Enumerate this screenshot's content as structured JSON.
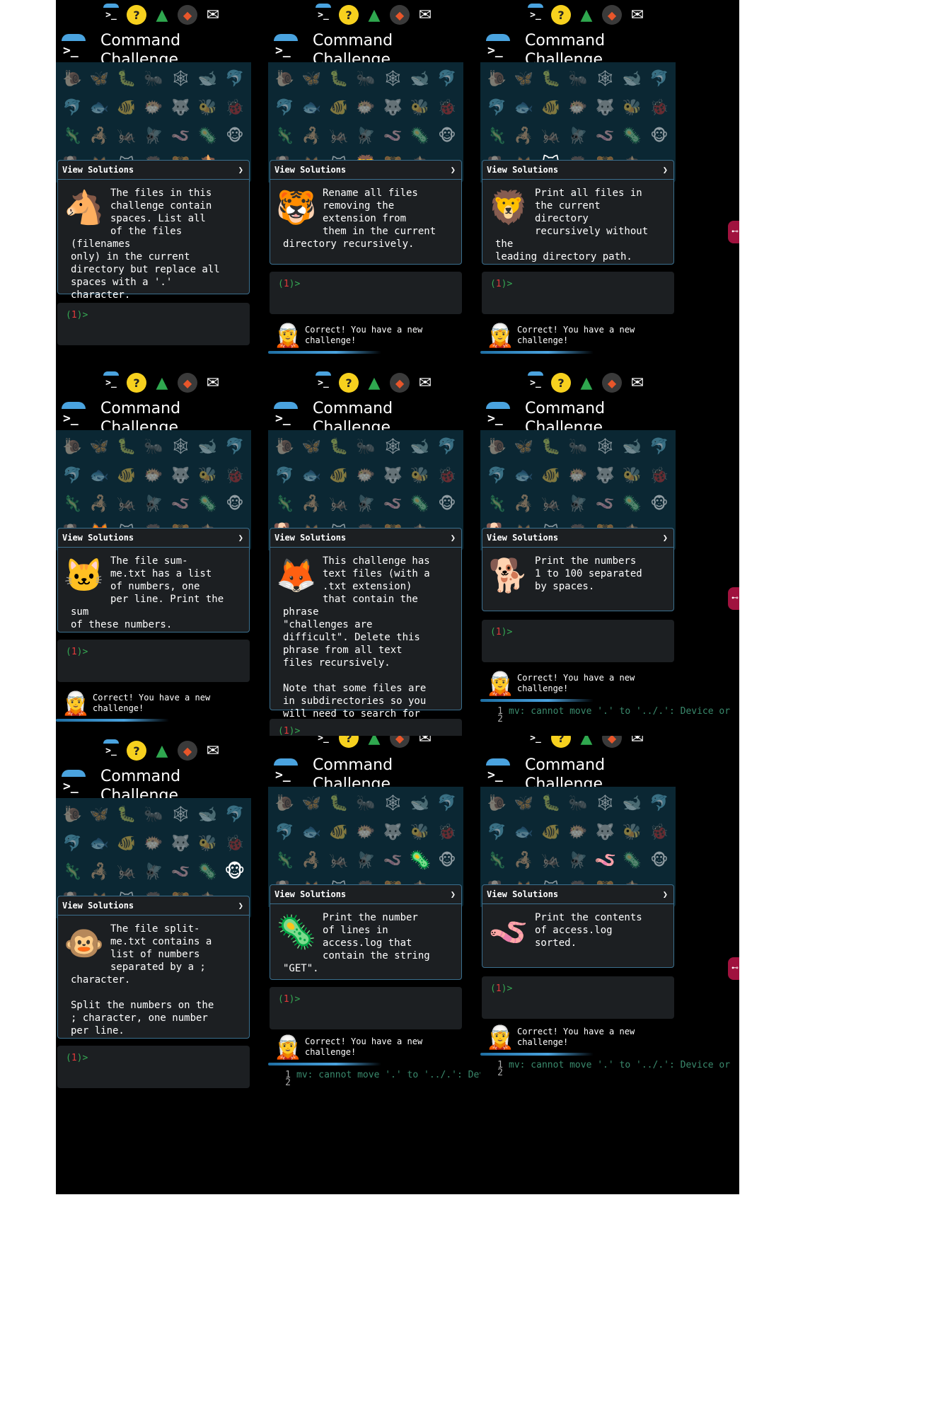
{
  "app": {
    "title_line1": "Command",
    "title_line2": "Challenge",
    "view_solutions": "View Solutions",
    "chevron": "❯",
    "prompt_open": "(",
    "prompt_num": "1",
    "prompt_close": ")>",
    "feedback": "Correct! You have a new challenge!",
    "side_glyph": "⊷",
    "output_text": "mv: cannot move '.' to '../.': Device or"
  },
  "toolbar_icons": [
    "terminal-icon",
    "thinking-face-icon",
    "tree-icon",
    "gitlab-icon",
    "mail-icon"
  ],
  "animals": [
    "🐌",
    "🦋",
    "🐛",
    "🐜",
    "🕸",
    "🐋",
    "🐬",
    "🐬",
    "🐟",
    "🐠",
    "🐡",
    "🐺",
    "🐝",
    "🐞",
    "🦎",
    "🦂",
    "🦗",
    "🪰",
    "🪱",
    "🦠",
    "🐵",
    "🐕",
    "🦊",
    "🐱",
    "🦁",
    "🐯",
    "🐴"
  ],
  "panels": [
    {
      "active": 26,
      "text": "The files in this\nchallenge contain\nspaces. List all\nof the files (filenames\nonly) in the current\ndirectory but replace all\nspaces with a '.'\ncharacter.",
      "icon": "🐴"
    },
    {
      "active": 24,
      "text": "Rename all files\nremoving the\nextension from\nthem in the current\ndirectory recursively.",
      "icon": "🐯"
    },
    {
      "active": 23,
      "text": "Print all files in\nthe current\ndirectory\nrecursively without the\nleading directory path.",
      "icon": "🦁"
    },
    {
      "active": 22,
      "text": "The file sum-\nme.txt has a list\nof numbers, one\nper line. Print the sum\nof these numbers.",
      "icon": "🐱"
    },
    {
      "active": 21,
      "text": "This challenge has\ntext files (with a\n.txt extension)\nthat contain the phrase\n\"challenges are\ndifficult\". Delete this\nphrase from all text\nfiles recursively.\n\nNote that some files are\nin subdirectories so you\nwill need to search for\nthem.",
      "icon": "🦊"
    },
    {
      "active": 21,
      "text": "Print the numbers\n1 to 100 separated\nby spaces.",
      "icon": "🐕"
    },
    {
      "active": 20,
      "text": "The file split-\nme.txt contains a\nlist of numbers\nseparated by a ;\ncharacter.\n\nSplit the numbers on the\n; character, one number\nper line.",
      "icon": "🐵"
    },
    {
      "active": 19,
      "text": "Print the number\nof lines in\naccess.log that\ncontain the string \"GET\".",
      "icon": "🦠"
    },
    {
      "active": 18,
      "text": "Print the contents\nof access.log\nsorted.",
      "icon": "🪱"
    }
  ],
  "output_lines": [
    "1",
    "2"
  ]
}
